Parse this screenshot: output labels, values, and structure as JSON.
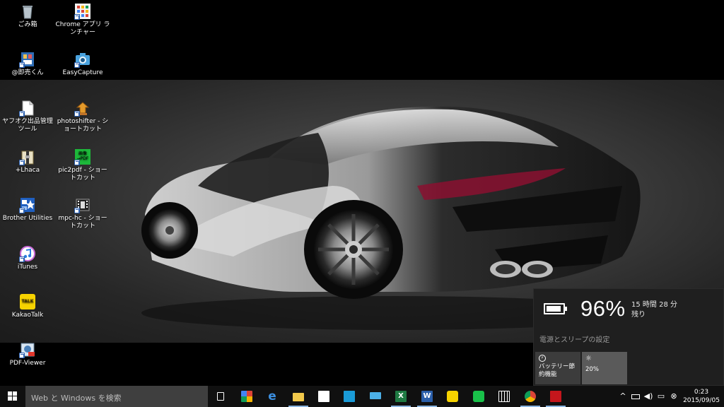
{
  "desktop": {
    "icons": [
      {
        "label": "ごみ箱",
        "icon": "recycle-bin-icon"
      },
      {
        "label": "Chrome アプリ ランチャー",
        "icon": "app-launcher-icon"
      },
      {
        "label": "@即売くん",
        "icon": "app-icon"
      },
      {
        "label": "EasyCapture",
        "icon": "camera-icon"
      },
      {
        "label": "ヤフオク出品管理ツール",
        "icon": "document-icon"
      },
      {
        "label": "photoshifter - ショートカット",
        "icon": "stamp-icon"
      },
      {
        "label": "+Lhaca",
        "icon": "archive-icon"
      },
      {
        "label": "pic2pdf - ショートカット",
        "icon": "pic2pdf-icon"
      },
      {
        "label": "Brother Utilities",
        "icon": "brother-icon"
      },
      {
        "label": "mpc-hc - ショートカット",
        "icon": "film-icon"
      },
      {
        "label": "iTunes",
        "icon": "itunes-icon"
      },
      {
        "label": "KakaoTalk",
        "icon": "kakaotalk-icon"
      },
      {
        "label": "PDF-Viewer",
        "icon": "pdf-viewer-icon"
      }
    ],
    "pic2pdf_glyph": "画像\n→PDF",
    "kakao_glyph": "TALK"
  },
  "battery_flyout": {
    "percent": "96%",
    "remaining_line1": "15 時間 28 分",
    "remaining_line2": "残り",
    "settings_link": "電源とスリープの設定",
    "tiles": {
      "saver_label": "バッテリー節約機能",
      "brightness_label": "20%"
    },
    "charge_fraction": 0.96
  },
  "taskbar": {
    "search_placeholder": "Web と Windows を検索",
    "apps": [
      "task-view",
      "app-launcher",
      "edge",
      "file-explorer",
      "store",
      "outlook",
      "notebook",
      "excel",
      "word",
      "kakaotalk",
      "line",
      "calculator",
      "chrome",
      "acrobat"
    ],
    "tray_chevron": "^",
    "clock_time": "0:23",
    "clock_date": "2015/09/05"
  },
  "colors": {
    "taskbar_bg": "#101010",
    "search_bg": "#3f3f3f",
    "flyout_bg": "#1f1f1f",
    "tile_active": "#5a5a5a"
  }
}
